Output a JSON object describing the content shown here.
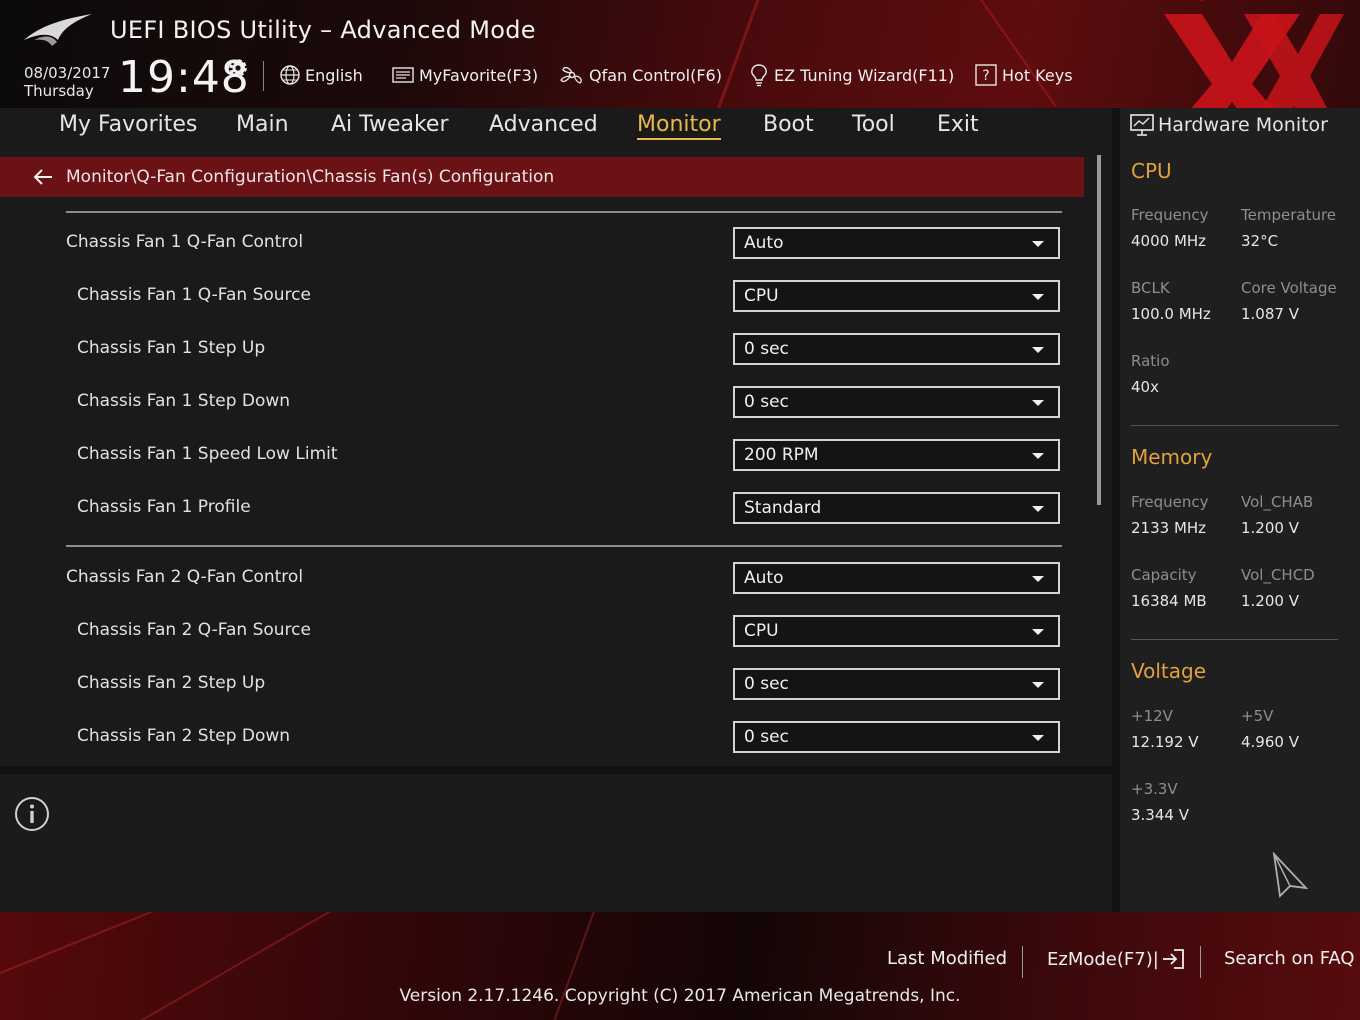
{
  "header": {
    "title": "UEFI BIOS Utility – Advanced Mode",
    "date": "08/03/2017",
    "day": "Thursday",
    "time": "19:48",
    "tools": [
      {
        "label": "English",
        "icon": "globe-icon"
      },
      {
        "label": "MyFavorite(F3)",
        "icon": "favorite-list-icon"
      },
      {
        "label": "Qfan Control(F6)",
        "icon": "fan-icon"
      },
      {
        "label": "EZ Tuning Wizard(F11)",
        "icon": "lightbulb-icon"
      },
      {
        "label": "Hot Keys",
        "icon": "question-box-icon"
      }
    ]
  },
  "nav": {
    "tabs": [
      {
        "label": "My Favorites"
      },
      {
        "label": "Main"
      },
      {
        "label": "Ai Tweaker"
      },
      {
        "label": "Advanced"
      },
      {
        "label": "Monitor",
        "active": true
      },
      {
        "label": "Boot"
      },
      {
        "label": "Tool"
      },
      {
        "label": "Exit"
      }
    ]
  },
  "breadcrumb": {
    "path": "Monitor\\Q-Fan Configuration\\Chassis Fan(s) Configuration"
  },
  "settings": {
    "items": [
      {
        "label": "Chassis Fan 1 Q-Fan Control",
        "value": "Auto"
      },
      {
        "label": "Chassis Fan 1 Q-Fan Source",
        "value": "CPU"
      },
      {
        "label": "Chassis Fan 1 Step Up",
        "value": "0 sec"
      },
      {
        "label": "Chassis Fan 1 Step Down",
        "value": "0 sec"
      },
      {
        "label": "Chassis Fan 1 Speed Low Limit",
        "value": "200 RPM"
      },
      {
        "label": "Chassis Fan 1 Profile",
        "value": "Standard"
      },
      {
        "label": "Chassis Fan 2 Q-Fan Control",
        "value": "Auto"
      },
      {
        "label": "Chassis Fan 2 Q-Fan Source",
        "value": "CPU"
      },
      {
        "label": "Chassis Fan 2 Step Up",
        "value": "0 sec"
      },
      {
        "label": "Chassis Fan 2 Step Down",
        "value": "0 sec"
      }
    ]
  },
  "hardware_monitor": {
    "title": "Hardware Monitor",
    "cpu": {
      "heading": "CPU",
      "frequency_label": "Frequency",
      "frequency": "4000 MHz",
      "temperature_label": "Temperature",
      "temperature": "32°C",
      "bclk_label": "BCLK",
      "bclk": "100.0 MHz",
      "core_voltage_label": "Core Voltage",
      "core_voltage": "1.087 V",
      "ratio_label": "Ratio",
      "ratio": "40x"
    },
    "memory": {
      "heading": "Memory",
      "frequency_label": "Frequency",
      "frequency": "2133 MHz",
      "vol_chab_label": "Vol_CHAB",
      "vol_chab": "1.200 V",
      "capacity_label": "Capacity",
      "capacity": "16384 MB",
      "vol_chcd_label": "Vol_CHCD",
      "vol_chcd": "1.200 V"
    },
    "voltage": {
      "heading": "Voltage",
      "v12_label": "+12V",
      "v12": "12.192 V",
      "v5_label": "+5V",
      "v5": "4.960 V",
      "v33_label": "+3.3V",
      "v33": "3.344 V"
    }
  },
  "footer": {
    "last_modified": "Last Modified",
    "ezmode": "EzMode(F7)|",
    "search_faq": "Search on FAQ",
    "version": "Version 2.17.1246. Copyright (C) 2017 American Megatrends, Inc."
  },
  "colors": {
    "accent_gold": "#e8b84a",
    "section_orange": "#e0a23a",
    "breadcrumb_red": "#6a1216",
    "background": "#1a1a1a"
  }
}
